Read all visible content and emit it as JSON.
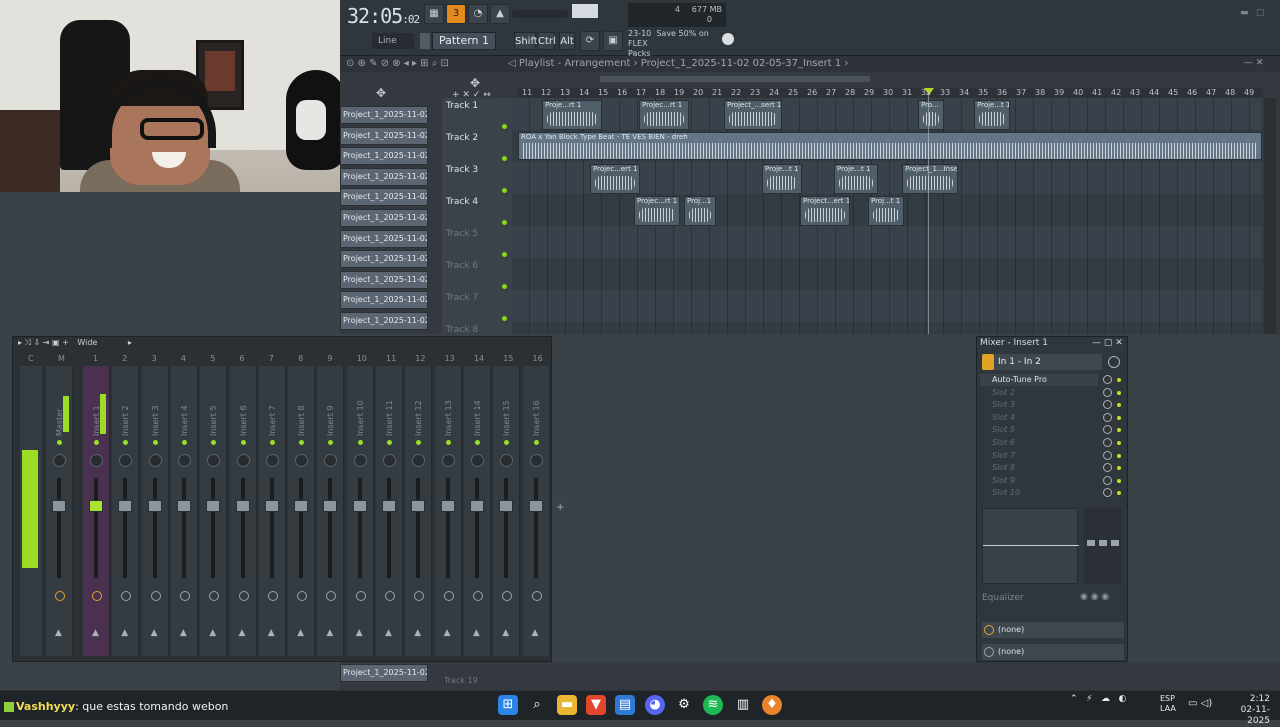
{
  "transport": {
    "time_main": "32:05",
    "time_sub": "02",
    "snap_mode": "Line",
    "pattern": "Pattern 1",
    "shift": "Shift",
    "ctrl": "Ctrl",
    "alt": "Alt"
  },
  "memory": {
    "value": "677 MB",
    "cpu": "4",
    "polyphony": "0"
  },
  "news": {
    "date": "23-10",
    "headline": "Save 50% on FLEX",
    "sub": "Packs"
  },
  "playlist": {
    "title": "Playlist - Arrangement",
    "project": "Project_1_2025-11-02 02-05-37_Insert 1",
    "ruler": [
      "11",
      "12",
      "13",
      "14",
      "15",
      "16",
      "17",
      "18",
      "19",
      "20",
      "21",
      "22",
      "23",
      "24",
      "25",
      "26",
      "27",
      "28",
      "29",
      "30",
      "31",
      "32",
      "33",
      "34",
      "35",
      "36",
      "37",
      "38",
      "39",
      "40",
      "41",
      "42",
      "43",
      "44",
      "45",
      "46",
      "47",
      "48",
      "49"
    ],
    "picker": [
      "Project_1_2025-11-02 0..",
      "Project_1_2025-11-02 0..",
      "Project_1_2025-11-02 0..",
      "Project_1_2025-11-02 0..",
      "Project_1_2025-11-02 0..",
      "Project_1_2025-11-02 0..",
      "Project_1_2025-11-02 0..",
      "Project_1_2025-11-02 0..",
      "Project_1_2025-11-02 0..",
      "Project_1_2025-11-02 0..",
      "Project_1_2025-11-02 0.."
    ],
    "tracks": [
      "Track 1",
      "Track 2",
      "Track 3",
      "Track 4",
      "Track 5",
      "Track 6",
      "Track 7",
      "Track 8"
    ],
    "bottom_track": "Track 19",
    "track2_clip": "ROA x Yan Block Type Beat - TE VES BIEN - dreh",
    "clips_t1": [
      "Proje...rt 1",
      "Projec...rt 1",
      "Project_...sert 1",
      "Pro...",
      "Proje...t 1"
    ],
    "clips_t3": [
      "Projec...ert 1",
      "Proje...t 1",
      "Proje...t 1",
      "Project_1...Insert 1"
    ],
    "clips_t4": [
      "Projec...rt 1",
      "Proj...1",
      "Project...ert 1",
      "Proj...t 1"
    ]
  },
  "mixer": {
    "preset": "Wide",
    "channel_numbers": [
      "C",
      "M",
      "1",
      "2",
      "3",
      "4",
      "5",
      "6",
      "7",
      "8",
      "9",
      "10",
      "11",
      "12",
      "13",
      "14",
      "15",
      "16"
    ],
    "channels": [
      "Master",
      "Insert 1",
      "Insert 2",
      "Insert 3",
      "Insert 4",
      "Insert 5",
      "Insert 6",
      "Insert 7",
      "Insert 8",
      "Insert 9",
      "Insert 10",
      "Insert 11",
      "Insert 12",
      "Insert 13",
      "Insert 14",
      "Insert 15",
      "Insert 16"
    ]
  },
  "insert_panel": {
    "title": "Mixer - Insert 1",
    "routing": "In 1 - In 2",
    "slots": [
      "Auto-Tune Pro",
      "Slot 2",
      "Slot 3",
      "Slot 4",
      "Slot 5",
      "Slot 6",
      "Slot 7",
      "Slot 8",
      "Slot 9",
      "Slot 10"
    ],
    "eq_label": "Equalizer",
    "out1": "(none)",
    "out2": "(none)"
  },
  "chat": {
    "user": "Vashhyyy",
    "message": ": que estas tomando webon"
  },
  "tray": {
    "lang": "ESP",
    "lang2": "LAA",
    "time": "2:12",
    "date": "02-11-2025"
  },
  "colors": {
    "accent": "#9ddc25",
    "orange": "#e28a1e",
    "bg": "#3a4147"
  }
}
